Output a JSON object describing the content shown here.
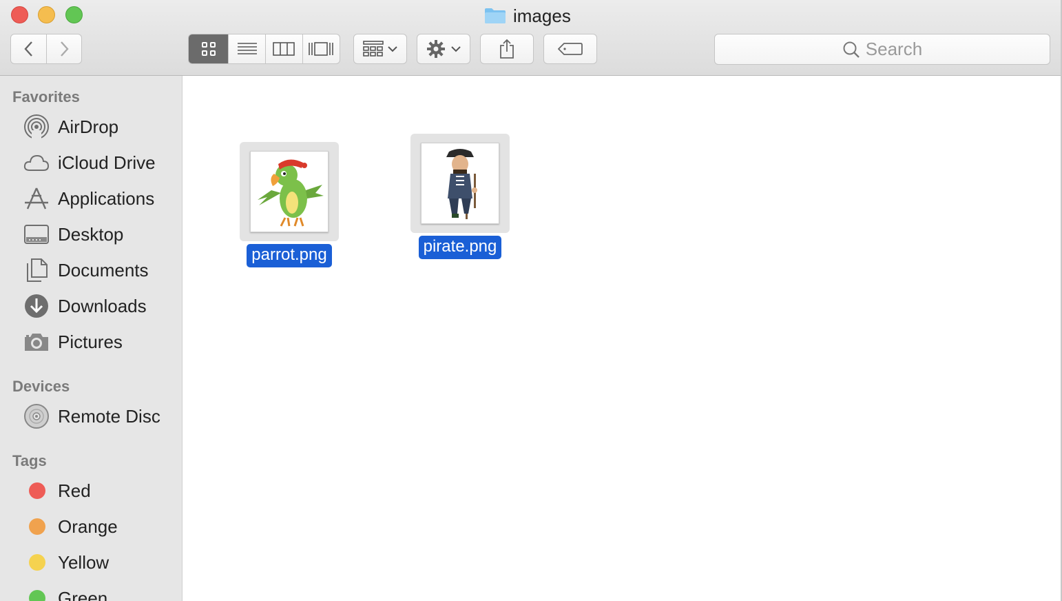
{
  "window": {
    "title": "images"
  },
  "toolbar": {
    "search_placeholder": "Search"
  },
  "sidebar": {
    "favorites_title": "Favorites",
    "favorites": [
      {
        "label": "AirDrop",
        "icon": "airdrop-icon"
      },
      {
        "label": "iCloud Drive",
        "icon": "cloud-icon"
      },
      {
        "label": "Applications",
        "icon": "applications-icon"
      },
      {
        "label": "Desktop",
        "icon": "desktop-icon"
      },
      {
        "label": "Documents",
        "icon": "documents-icon"
      },
      {
        "label": "Downloads",
        "icon": "downloads-icon"
      },
      {
        "label": "Pictures",
        "icon": "camera-icon"
      }
    ],
    "devices_title": "Devices",
    "devices": [
      {
        "label": "Remote Disc",
        "icon": "disc-icon"
      }
    ],
    "tags_title": "Tags",
    "tags": [
      {
        "label": "Red",
        "color": "#ee5c56"
      },
      {
        "label": "Orange",
        "color": "#f0a24e"
      },
      {
        "label": "Yellow",
        "color": "#f5d24f"
      },
      {
        "label": "Green",
        "color": "#62c654"
      }
    ]
  },
  "files": [
    {
      "name": "parrot.png",
      "selected": true
    },
    {
      "name": "pirate.png",
      "selected": true
    }
  ],
  "colors": {
    "selection": "#1a5fd6",
    "active_view": "#6b6b6b"
  }
}
